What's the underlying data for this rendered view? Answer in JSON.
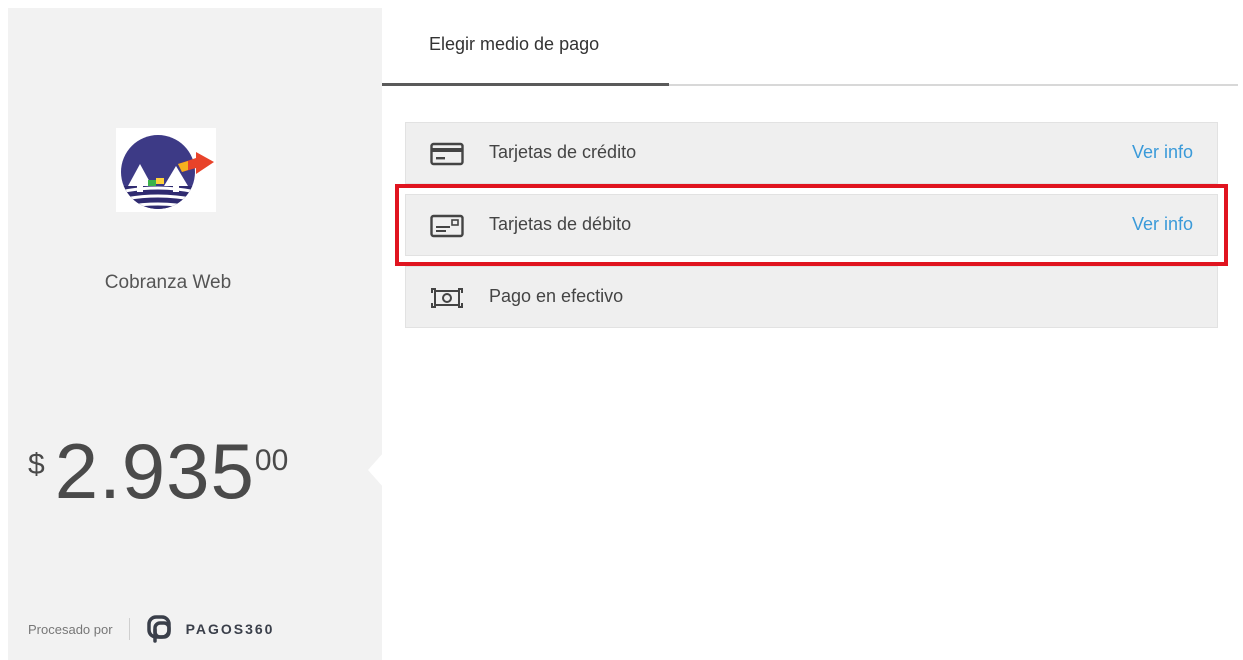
{
  "merchant": {
    "name": "Cobranza Web",
    "logo_icon": "merchant-logo"
  },
  "amount": {
    "currency": "$",
    "integer": "2.935",
    "cents": "00"
  },
  "footer": {
    "processed_label": "Procesado por",
    "brand_name": "PAGOS360",
    "brand_icon": "pagos360-logo-icon"
  },
  "tabs": [
    {
      "label": "Elegir medio de pago",
      "active": true
    }
  ],
  "methods": [
    {
      "label": "Tarjetas de crédito",
      "info_label": "Ver info",
      "icon": "credit-card-icon"
    },
    {
      "label": "Tarjetas de débito",
      "info_label": "Ver info",
      "icon": "debit-card-icon",
      "highlighted": true
    },
    {
      "label": "Pago en efectivo",
      "icon": "cash-icon"
    }
  ],
  "colors": {
    "link": "#3a9ad9",
    "highlight_border": "#e0141f",
    "panel_bg": "#f2f2f2"
  }
}
